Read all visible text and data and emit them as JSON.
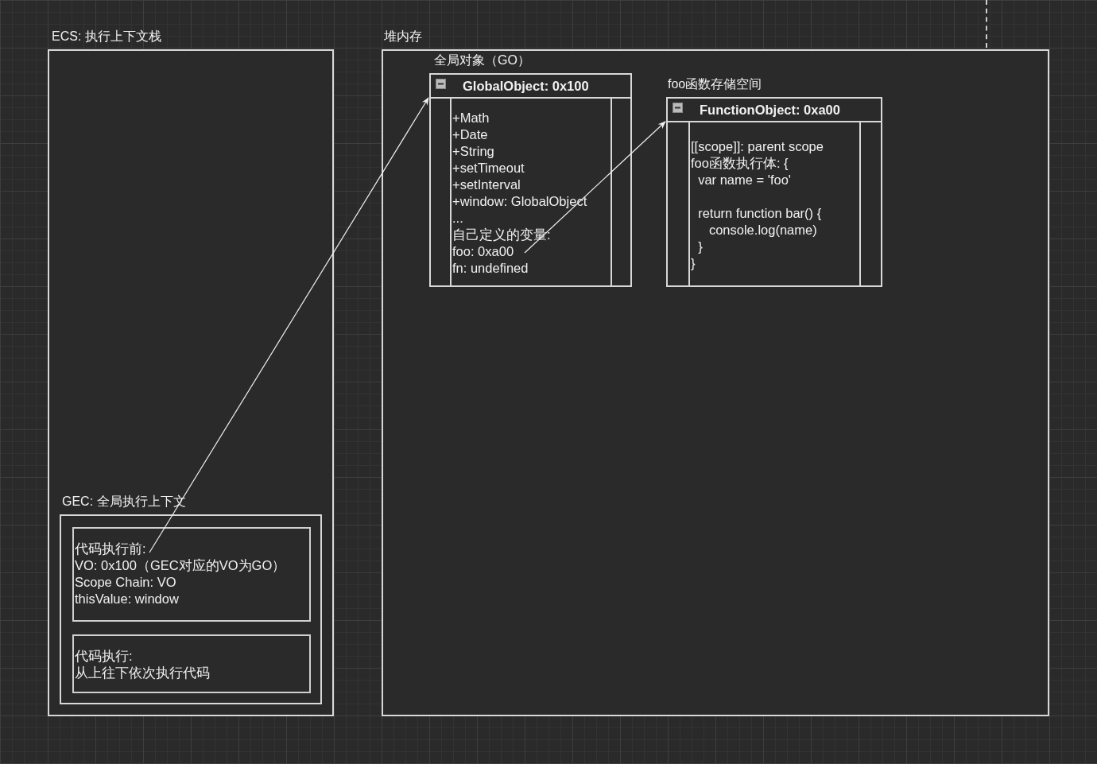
{
  "ecs": {
    "title": "ECS: 执行上下文栈",
    "gec": {
      "title": "GEC: 全局执行上下文",
      "sections": [
        {
          "lines": [
            "代码执行前:",
            "VO: 0x100（GEC对应的VO为GO）",
            "Scope Chain: VO",
            "thisValue: window"
          ]
        },
        {
          "lines": [
            "代码执行:",
            "从上往下依次执行代码"
          ]
        }
      ]
    }
  },
  "heap": {
    "title": "堆内存",
    "objects": [
      {
        "caption": "全局对象（GO）",
        "header": "GlobalObject: 0x100",
        "expanded": true,
        "lines": [
          "+Math",
          "+Date",
          "+String",
          "+setTimeout",
          "+setInterval",
          "+window: GlobalObject",
          "...",
          "自己定义的变量:",
          "foo: 0xa00",
          "fn: undefined"
        ]
      },
      {
        "caption": "foo函数存储空间",
        "header": "FunctionObject: 0xa00",
        "expanded": true,
        "lines": [
          {
            "text": "[[scope]]: parent scope"
          },
          {
            "text": "foo函数执行体: {"
          },
          {
            "text": "  var name = 'foo'"
          },
          {
            "text": "  return function bar() {",
            "space_before": true
          },
          {
            "text": "     console.log(name)"
          },
          {
            "text": "  }"
          },
          {
            "text": "}"
          }
        ]
      }
    ]
  }
}
